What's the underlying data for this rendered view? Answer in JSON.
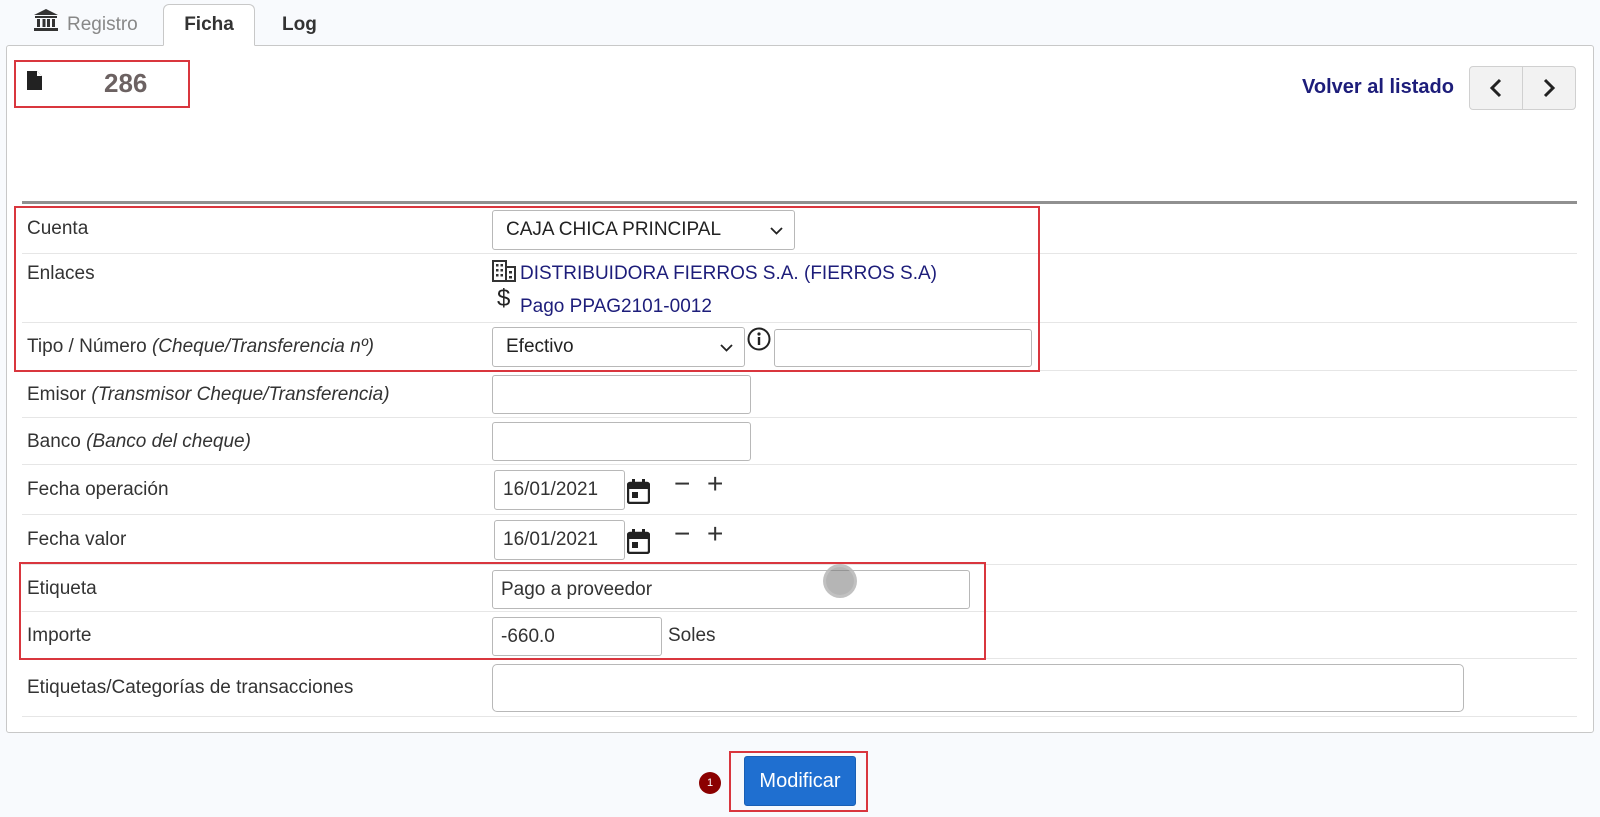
{
  "tabs": {
    "registro": "Registro",
    "ficha": "Ficha",
    "log": "Log"
  },
  "header": {
    "ref_number": "286",
    "back_link": "Volver al listado"
  },
  "form": {
    "cuenta": {
      "label": "Cuenta",
      "value": "CAJA CHICA PRINCIPAL"
    },
    "enlaces": {
      "label": "Enlaces",
      "company_link": "DISTRIBUIDORA FIERROS S.A. (FIERROS S.A)",
      "payment_link": "Pago PPAG2101-0012"
    },
    "tipo": {
      "label": "Tipo / Número ",
      "hint": "(Cheque/Transferencia nº)",
      "value": "Efectivo",
      "number": ""
    },
    "emisor": {
      "label": "Emisor ",
      "hint": "(Transmisor Cheque/Transferencia)",
      "value": ""
    },
    "banco": {
      "label": "Banco ",
      "hint": "(Banco del cheque)",
      "value": ""
    },
    "fecha_operacion": {
      "label": "Fecha operación",
      "value": "16/01/2021",
      "minus": "−",
      "plus": "+"
    },
    "fecha_valor": {
      "label": "Fecha valor",
      "value": "16/01/2021",
      "minus": "−",
      "plus": "+"
    },
    "etiqueta": {
      "label": "Etiqueta",
      "value": "Pago a proveedor"
    },
    "importe": {
      "label": "Importe",
      "value": "-660.0",
      "currency": "Soles"
    },
    "categorias": {
      "label": "Etiquetas/Categorías de transacciones",
      "value": ""
    }
  },
  "actions": {
    "modify": "Modificar",
    "badge": "1"
  },
  "colors": {
    "link": "#1d1d7a",
    "primary_button": "#1f6fd0",
    "highlight_border": "#d9363e",
    "badge": "#8b0000"
  }
}
